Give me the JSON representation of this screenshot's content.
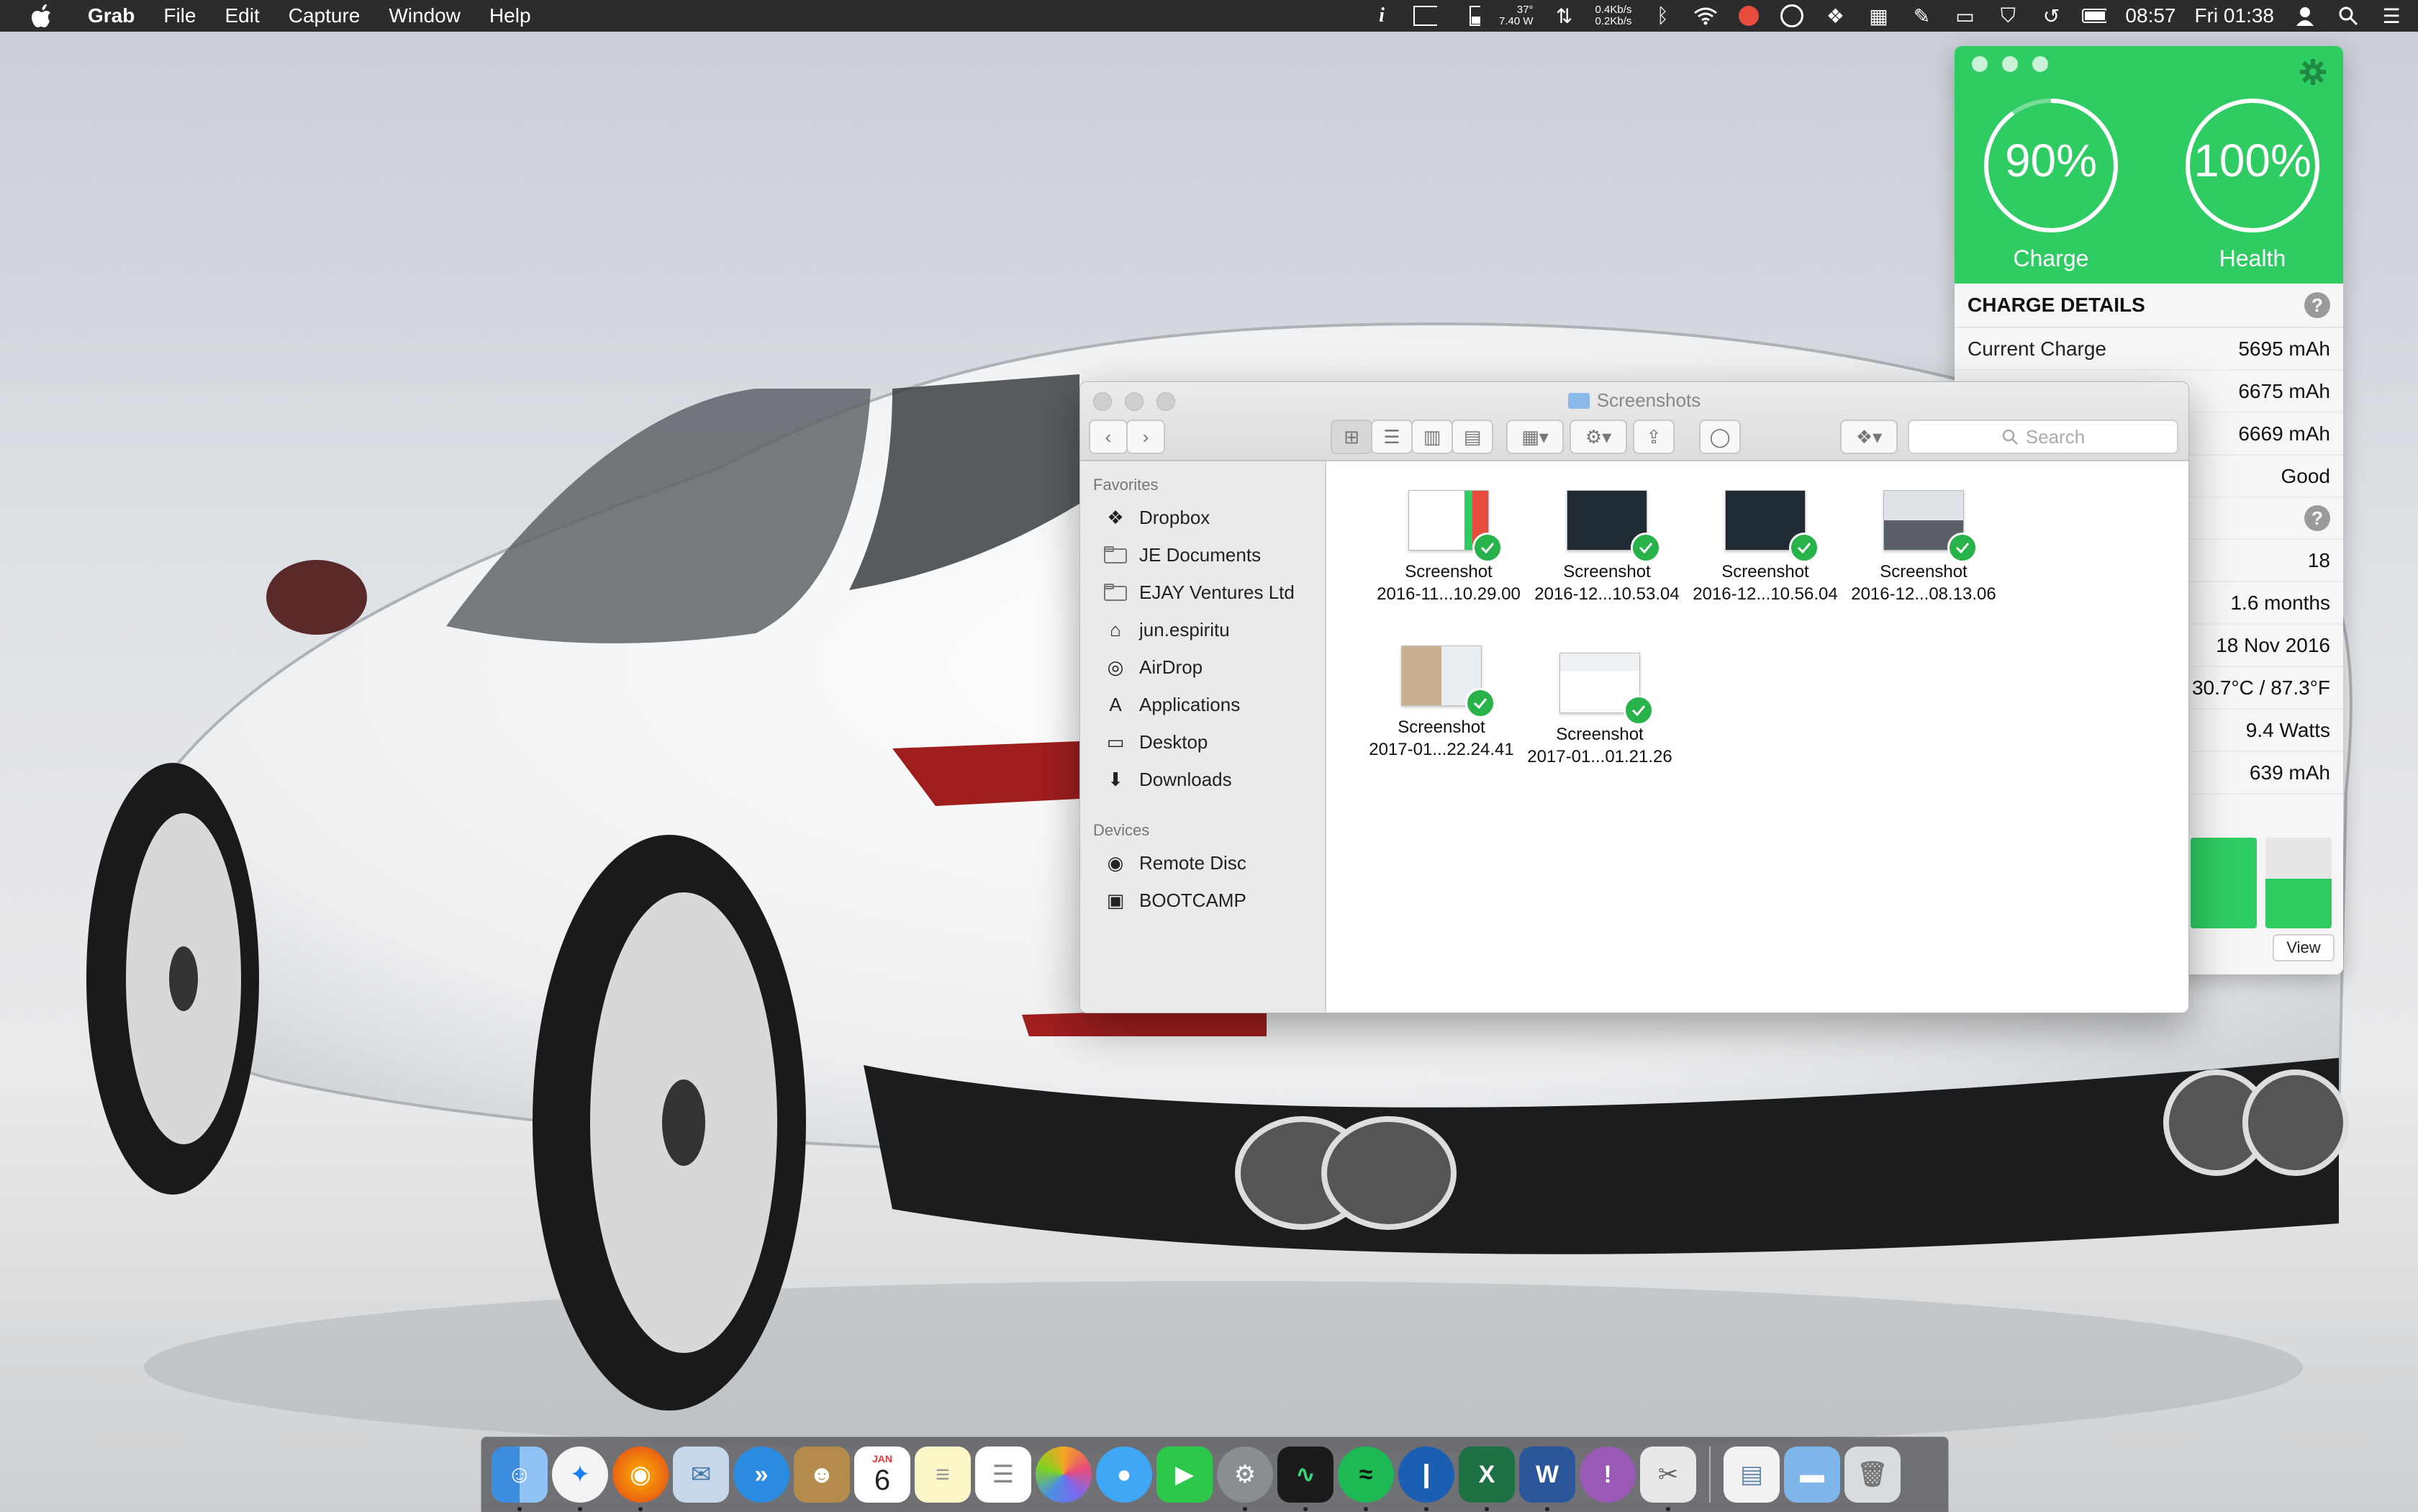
{
  "menubar": {
    "app_name": "Grab",
    "menus": [
      "File",
      "Edit",
      "Capture",
      "Window",
      "Help"
    ],
    "status": {
      "temp": "37°",
      "power": "7.40 W",
      "net_up": "0.4Kb/s",
      "net_down": "0.2Kb/s",
      "battery_time": "08:57",
      "clock": "Fri 01:38"
    }
  },
  "battery_widget": {
    "charge": {
      "value": "90%",
      "label": "Charge",
      "fraction": 0.9
    },
    "health": {
      "value": "100%",
      "label": "Health",
      "fraction": 1.0
    },
    "section_title": "CHARGE DETAILS",
    "help": "?",
    "rows": [
      {
        "label": "Current Charge",
        "value": "5695 mAh"
      },
      {
        "label": "",
        "value": "6675 mAh"
      },
      {
        "label": "",
        "value": "6669 mAh"
      },
      {
        "label": "",
        "value": "Good"
      }
    ],
    "rows2": [
      {
        "label": "",
        "value": "18"
      },
      {
        "label": "",
        "value": "1.6 months"
      },
      {
        "label": "",
        "value": "18 Nov 2016"
      },
      {
        "label": "",
        "value": "30.7°C / 87.3°F"
      },
      {
        "label": "",
        "value": "9.4 Watts"
      },
      {
        "label": "",
        "value": "639 mAh"
      }
    ],
    "bars": [
      1.0,
      0.55
    ],
    "view_label": "View",
    "colors": {
      "accent": "#2ecc63"
    }
  },
  "finder": {
    "title": "Screenshots",
    "search_placeholder": "Search",
    "sidebar": {
      "favorites_label": "Favorites",
      "favorites": [
        {
          "label": "Dropbox",
          "icon": "dropbox-icon"
        },
        {
          "label": "JE Documents",
          "icon": "folder-icon"
        },
        {
          "label": "EJAY Ventures Ltd",
          "icon": "folder-icon"
        },
        {
          "label": "jun.espiritu",
          "icon": "home-icon"
        },
        {
          "label": "AirDrop",
          "icon": "airdrop-icon"
        },
        {
          "label": "Applications",
          "icon": "applications-icon"
        },
        {
          "label": "Desktop",
          "icon": "desktop-icon"
        },
        {
          "label": "Downloads",
          "icon": "downloads-icon"
        }
      ],
      "devices_label": "Devices",
      "devices": [
        {
          "label": "Remote Disc",
          "icon": "disc-icon"
        },
        {
          "label": "BOOTCAMP",
          "icon": "drive-icon"
        }
      ]
    },
    "files": [
      {
        "name": "Screenshot",
        "date": "2016-11...10.29.00"
      },
      {
        "name": "Screenshot",
        "date": "2016-12...10.53.04"
      },
      {
        "name": "Screenshot",
        "date": "2016-12...10.56.04"
      },
      {
        "name": "Screenshot",
        "date": "2016-12...08.13.06"
      },
      {
        "name": "Screenshot",
        "date": "2017-01...22.24.41"
      },
      {
        "name": "Screenshot",
        "date": "2017-01...01.21.26"
      }
    ]
  },
  "dock": {
    "apps": [
      "finder-icon",
      "safari-icon",
      "firefox-icon",
      "mail-icon",
      "fast-forward-icon",
      "contacts-icon",
      "calendar-icon",
      "notes-icon",
      "reminders-icon",
      "photos-icon",
      "messages-icon",
      "facetime-icon",
      "system-preferences-icon",
      "activity-monitor-icon",
      "spotify-icon",
      "1password-icon",
      "excel-icon",
      "word-icon",
      "purple-app-icon",
      "preview-icon"
    ],
    "calendar": {
      "month": "JAN",
      "day": "6"
    },
    "excel_letter": "X",
    "word_letter": "W",
    "folders": [
      "documents-stack-icon",
      "applications-folder-icon",
      "trash-icon"
    ]
  }
}
